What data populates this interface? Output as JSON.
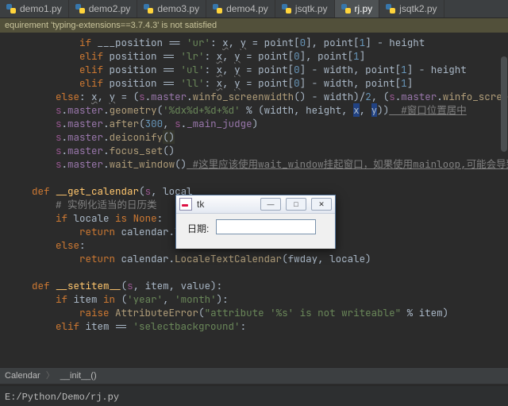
{
  "tabs": {
    "items": [
      {
        "label": "demo1.py"
      },
      {
        "label": "demo2.py"
      },
      {
        "label": "demo3.py"
      },
      {
        "label": "demo4.py"
      },
      {
        "label": "jsqtk.py"
      },
      {
        "label": "rj.py"
      },
      {
        "label": "jsqtk2.py"
      }
    ],
    "activeIndex": 5
  },
  "warning": "equirement 'typing-extensions==3.7.4.3' is not satisfied",
  "code_lines": [
    {
      "indent": 12,
      "tokens": [
        [
          "kw",
          "if "
        ],
        [
          "par",
          "___position == "
        ],
        [
          "str",
          "'ur'"
        ],
        [
          "par",
          ": "
        ],
        [
          "un",
          "x"
        ],
        [
          "par",
          ", "
        ],
        [
          "un",
          "y"
        ],
        [
          "par",
          " = point["
        ],
        [
          "num",
          "0"
        ],
        [
          "par",
          "], point["
        ],
        [
          "num",
          "1"
        ],
        [
          "par",
          "] - height"
        ]
      ]
    },
    {
      "indent": 12,
      "tokens": [
        [
          "kw",
          "elif "
        ],
        [
          "par",
          "position == "
        ],
        [
          "str",
          "'lr'"
        ],
        [
          "par",
          ": "
        ],
        [
          "un",
          "x"
        ],
        [
          "par",
          ", "
        ],
        [
          "un",
          "y"
        ],
        [
          "par",
          " = point["
        ],
        [
          "num",
          "0"
        ],
        [
          "par",
          "], point["
        ],
        [
          "num",
          "1"
        ],
        [
          "par",
          "]"
        ]
      ]
    },
    {
      "indent": 12,
      "tokens": [
        [
          "kw",
          "elif "
        ],
        [
          "par",
          "position == "
        ],
        [
          "str",
          "'ul'"
        ],
        [
          "par",
          ": "
        ],
        [
          "un",
          "x"
        ],
        [
          "par",
          ", "
        ],
        [
          "un",
          "y"
        ],
        [
          "par",
          " = point["
        ],
        [
          "num",
          "0"
        ],
        [
          "par",
          "] - width, point["
        ],
        [
          "num",
          "1"
        ],
        [
          "par",
          "] - height"
        ]
      ]
    },
    {
      "indent": 12,
      "tokens": [
        [
          "kw",
          "elif "
        ],
        [
          "par",
          "position == "
        ],
        [
          "str",
          "'ll'"
        ],
        [
          "par",
          ": "
        ],
        [
          "un",
          "x"
        ],
        [
          "par",
          ", "
        ],
        [
          "un",
          "y"
        ],
        [
          "par",
          " = point["
        ],
        [
          "num",
          "0"
        ],
        [
          "par",
          "] - width, point["
        ],
        [
          "num",
          "1"
        ],
        [
          "par",
          "]"
        ]
      ]
    },
    {
      "indent": 8,
      "tokens": [
        [
          "kw",
          "else"
        ],
        [
          "par",
          ": "
        ],
        [
          "un",
          "x"
        ],
        [
          "par",
          ", "
        ],
        [
          "un",
          "y"
        ],
        [
          "par",
          " = ("
        ],
        [
          "slf",
          "s"
        ],
        [
          "par",
          "."
        ],
        [
          "id",
          "master"
        ],
        [
          "par",
          "."
        ],
        [
          "mfn",
          "winfo_screenwidth"
        ],
        [
          "par",
          "() - width)/"
        ],
        [
          "num",
          "2"
        ],
        [
          "par",
          ", ("
        ],
        [
          "slf",
          "s"
        ],
        [
          "par",
          "."
        ],
        [
          "id",
          "master"
        ],
        [
          "par",
          "."
        ],
        [
          "mfn",
          "winfo_screenheight"
        ],
        [
          "par",
          "("
        ]
      ]
    },
    {
      "indent": 8,
      "tokens": [
        [
          "slf",
          "s"
        ],
        [
          "par",
          "."
        ],
        [
          "id",
          "master"
        ],
        [
          "par",
          "."
        ],
        [
          "mfn",
          "geometry"
        ],
        [
          "par",
          "("
        ],
        [
          "str",
          "'%dx%d+%d+%d'"
        ],
        [
          "par",
          " % (width, height, "
        ],
        [
          "box",
          "x"
        ],
        [
          "par",
          ", "
        ],
        [
          "box",
          "y"
        ],
        [
          "par",
          "))"
        ],
        [
          "cm un2",
          "  #窗口位置居中"
        ]
      ]
    },
    {
      "indent": 8,
      "tokens": [
        [
          "slf",
          "s"
        ],
        [
          "par",
          "."
        ],
        [
          "id",
          "master"
        ],
        [
          "par",
          "."
        ],
        [
          "mfn",
          "after"
        ],
        [
          "par",
          "("
        ],
        [
          "num",
          "300"
        ],
        [
          "par",
          ", "
        ],
        [
          "slf",
          "s"
        ],
        [
          "par",
          "."
        ],
        [
          "id",
          "_main_judge"
        ],
        [
          "par",
          ")"
        ]
      ]
    },
    {
      "indent": 8,
      "tokens": [
        [
          "slf",
          "s"
        ],
        [
          "par",
          "."
        ],
        [
          "id",
          "master"
        ],
        [
          "par",
          "."
        ],
        [
          "mfn",
          "deiconify"
        ],
        [
          "hlp",
          "()"
        ]
      ]
    },
    {
      "indent": 8,
      "tokens": [
        [
          "slf",
          "s"
        ],
        [
          "par",
          "."
        ],
        [
          "id",
          "master"
        ],
        [
          "par",
          "."
        ],
        [
          "mfn",
          "focus_set"
        ],
        [
          "par",
          "()"
        ]
      ]
    },
    {
      "indent": 8,
      "tokens": [
        [
          "slf",
          "s"
        ],
        [
          "par",
          "."
        ],
        [
          "id",
          "master"
        ],
        [
          "par",
          "."
        ],
        [
          "mfn",
          "wait_window"
        ],
        [
          "par",
          "()"
        ],
        [
          "cm un2",
          " #这里应该使用wait_window挂起窗口，如果使用mainloop,可能会导致主程序很"
        ]
      ]
    },
    {
      "indent": 0,
      "tokens": []
    },
    {
      "indent": 4,
      "tokens": [
        [
          "kw",
          "def "
        ],
        [
          "fn",
          "__get_calendar"
        ],
        [
          "par",
          "("
        ],
        [
          "slf",
          "s"
        ],
        [
          "par",
          ", local"
        ]
      ]
    },
    {
      "indent": 8,
      "tokens": [
        [
          "cm",
          "# 实例化适当的日历类"
        ]
      ]
    },
    {
      "indent": 8,
      "tokens": [
        [
          "kw",
          "if "
        ],
        [
          "par",
          "locale "
        ],
        [
          "kw",
          "is "
        ],
        [
          "kw",
          "None"
        ],
        [
          "par",
          ":"
        ]
      ]
    },
    {
      "indent": 12,
      "tokens": [
        [
          "kw",
          "return "
        ],
        [
          "par",
          "calendar.Tex"
        ]
      ]
    },
    {
      "indent": 8,
      "tokens": [
        [
          "kw",
          "else"
        ],
        [
          "par",
          ":"
        ]
      ]
    },
    {
      "indent": 12,
      "tokens": [
        [
          "kw",
          "return "
        ],
        [
          "par",
          "calendar."
        ],
        [
          "mfn",
          "LocaleTextCalendar"
        ],
        [
          "par",
          "(fwday, locale)"
        ]
      ]
    },
    {
      "indent": 0,
      "tokens": []
    },
    {
      "indent": 4,
      "tokens": [
        [
          "kw",
          "def "
        ],
        [
          "fn",
          "__setitem__"
        ],
        [
          "par",
          "("
        ],
        [
          "slf",
          "s"
        ],
        [
          "par",
          ", item, value):"
        ]
      ]
    },
    {
      "indent": 8,
      "tokens": [
        [
          "kw",
          "if "
        ],
        [
          "par",
          "item "
        ],
        [
          "kw",
          "in "
        ],
        [
          "par",
          "("
        ],
        [
          "str",
          "'year'"
        ],
        [
          "par",
          ", "
        ],
        [
          "str",
          "'month'"
        ],
        [
          "par",
          "):"
        ]
      ]
    },
    {
      "indent": 12,
      "tokens": [
        [
          "kw",
          "raise "
        ],
        [
          "mfn",
          "AttributeError"
        ],
        [
          "par",
          "("
        ],
        [
          "str",
          "\"attribute '%s' is not writeable\""
        ],
        [
          "par",
          " % item)"
        ]
      ]
    },
    {
      "indent": 8,
      "tokens": [
        [
          "kw",
          "elif "
        ],
        [
          "par",
          "item == "
        ],
        [
          "str",
          "'selectbackground'"
        ],
        [
          "par",
          ":"
        ]
      ]
    }
  ],
  "breadcrumbs": {
    "a": "Calendar",
    "b": "__init__()"
  },
  "runbar": " E:/Python/Demo/rj.py",
  "tk": {
    "title": "tk",
    "label": "日期:",
    "entry_value": "",
    "min": "—",
    "max": "□",
    "close": "✕"
  }
}
